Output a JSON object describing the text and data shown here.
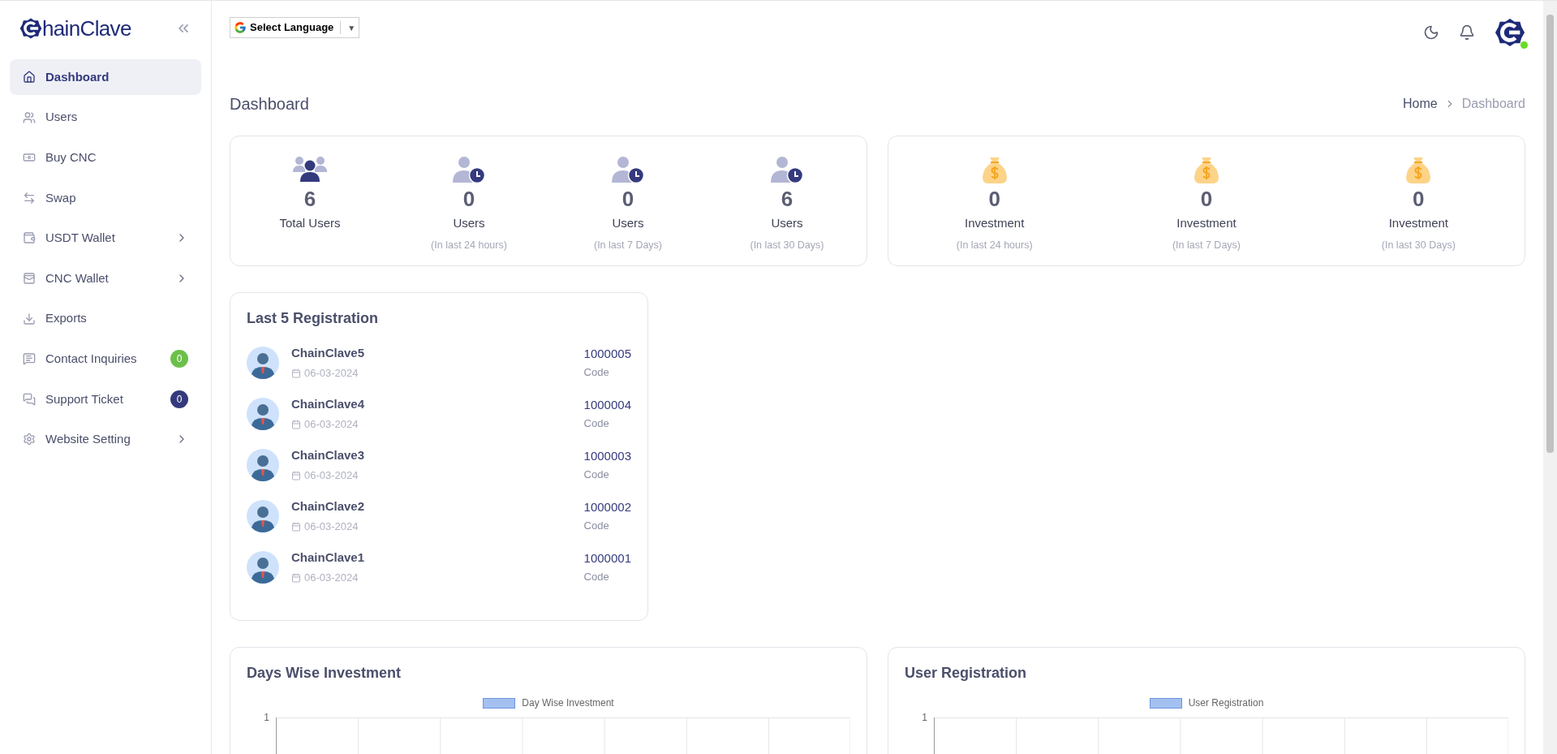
{
  "sidebar": {
    "logo_text": "hainClave",
    "items": [
      {
        "label": "Dashboard",
        "selected": true,
        "has_submenu": false
      },
      {
        "label": "Users",
        "selected": false,
        "has_submenu": false
      },
      {
        "label": "Buy CNC",
        "selected": false,
        "has_submenu": false
      },
      {
        "label": "Swap",
        "selected": false,
        "has_submenu": false
      },
      {
        "label": "USDT Wallet",
        "selected": false,
        "has_submenu": true
      },
      {
        "label": "CNC Wallet",
        "selected": false,
        "has_submenu": true
      },
      {
        "label": "Exports",
        "selected": false,
        "has_submenu": false
      },
      {
        "label": "Contact Inquiries",
        "selected": false,
        "has_submenu": false,
        "badge": "0",
        "color": "#6cc04a"
      },
      {
        "label": "Support Ticket",
        "selected": false,
        "has_submenu": false,
        "badge": "0",
        "color": "#343a7d"
      },
      {
        "label": "Website Setting",
        "selected": false,
        "has_submenu": true
      }
    ]
  },
  "topbar": {
    "language": {
      "label": "Select Language",
      "caret": "▼"
    },
    "user_online": true
  },
  "page": {
    "title": "Dashboard",
    "breadcrumb": [
      "Home",
      "Dashboard"
    ]
  },
  "user_stats": [
    {
      "kind": "total",
      "value": "6",
      "label": "Total Users"
    },
    {
      "kind": "period",
      "value": "0",
      "label": "Users",
      "sub": "(In last 24 hours)"
    },
    {
      "kind": "period",
      "value": "0",
      "label": "Users",
      "sub": "(In last 7 Days)"
    },
    {
      "kind": "period",
      "value": "6",
      "label": "Users",
      "sub": "(In last 30 Days)"
    }
  ],
  "investment_stats": [
    {
      "value": "0",
      "label": "Investment",
      "sub": "(In last 24 hours)"
    },
    {
      "value": "0",
      "label": "Investment",
      "sub": "(In last 7 Days)"
    },
    {
      "value": "0",
      "label": "Investment",
      "sub": "(In last 30 Days)"
    }
  ],
  "registrations": {
    "title": "Last 5 Registration",
    "rows": [
      {
        "name": "ChainClave5",
        "date": "06-03-2024",
        "code": "1000005",
        "code_label": "Code"
      },
      {
        "name": "ChainClave4",
        "date": "06-03-2024",
        "code": "1000004",
        "code_label": "Code"
      },
      {
        "name": "ChainClave3",
        "date": "06-03-2024",
        "code": "1000003",
        "code_label": "Code"
      },
      {
        "name": "ChainClave2",
        "date": "06-03-2024",
        "code": "1000002",
        "code_label": "Code"
      },
      {
        "name": "ChainClave1",
        "date": "06-03-2024",
        "code": "1000001",
        "code_label": "Code"
      }
    ]
  },
  "charts": [
    {
      "title": "Days Wise Investment",
      "legend": "Day Wise Investment",
      "top_tick": "1"
    },
    {
      "title": "User Registration",
      "legend": "User Registration",
      "top_tick": "1"
    }
  ]
}
